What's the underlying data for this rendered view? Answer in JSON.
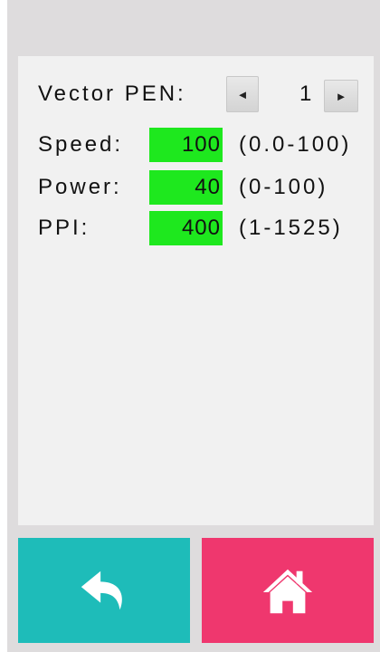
{
  "vector_pen": {
    "label": "Vector PEN:",
    "prev_icon": "triangle-left-icon",
    "value": "1",
    "next_icon": "triangle-right-icon"
  },
  "params": [
    {
      "label": "Speed:",
      "value": "100",
      "range": "(0.0-100)"
    },
    {
      "label": "Power:",
      "value": "40",
      "range": "(0-100)"
    },
    {
      "label": "PPI:",
      "value": "400",
      "range": "(1-1525)"
    }
  ],
  "buttons": {
    "back_icon": "back-arrow-icon",
    "home_icon": "home-icon"
  },
  "colors": {
    "background": "#dedcdd",
    "panel": "#f1f1f1",
    "value_box": "#1ee81e",
    "back_button": "#1ebcb9",
    "home_button": "#ef376e"
  }
}
